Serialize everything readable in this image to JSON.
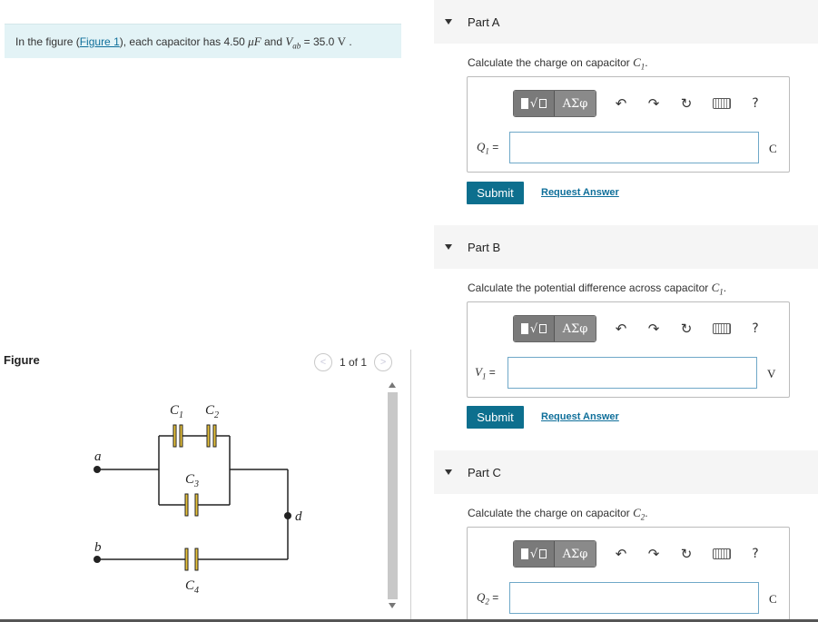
{
  "problem": {
    "text_prefix": "In the figure (",
    "figure_link": "Figure 1",
    "text_mid": "), each capacitor has 4.50 ",
    "unit_muF": "μF",
    "text_and": " and ",
    "vab_sym": "V",
    "vab_sub": "ab",
    "text_eq": " = 35.0 ",
    "unit_V": "V",
    "text_end": " ."
  },
  "figure": {
    "label": "Figure",
    "pager": "1 of 1",
    "prev_icon": "<",
    "next_icon": ">",
    "labels": {
      "c1": "C",
      "c1_sub": "1",
      "c2": "C",
      "c2_sub": "2",
      "c3": "C",
      "c3_sub": "3",
      "c4": "C",
      "c4_sub": "4",
      "a": "a",
      "b": "b",
      "d": "d"
    }
  },
  "toolbar": {
    "templates_icon": "√",
    "symbols_label": "ΑΣφ",
    "undo_icon": "↶",
    "redo_icon": "↷",
    "reset_icon": "↻",
    "help_icon": "?"
  },
  "parts": [
    {
      "title": "Part A",
      "prompt": "Calculate the charge on capacitor ",
      "sym": "C",
      "sym_sub": "1",
      "var": "Q",
      "var_sub": "1",
      "eq": " =",
      "unit": "C",
      "submit": "Submit",
      "request": "Request Answer"
    },
    {
      "title": "Part B",
      "prompt": "Calculate the potential difference across capacitor ",
      "sym": "C",
      "sym_sub": "1",
      "var": "V",
      "var_sub": "1",
      "eq": " =",
      "unit": "V",
      "submit": "Submit",
      "request": "Request Answer"
    },
    {
      "title": "Part C",
      "prompt": "Calculate the charge on capacitor ",
      "sym": "C",
      "sym_sub": "2",
      "var": "Q",
      "var_sub": "2",
      "eq": " =",
      "unit": "C"
    }
  ]
}
